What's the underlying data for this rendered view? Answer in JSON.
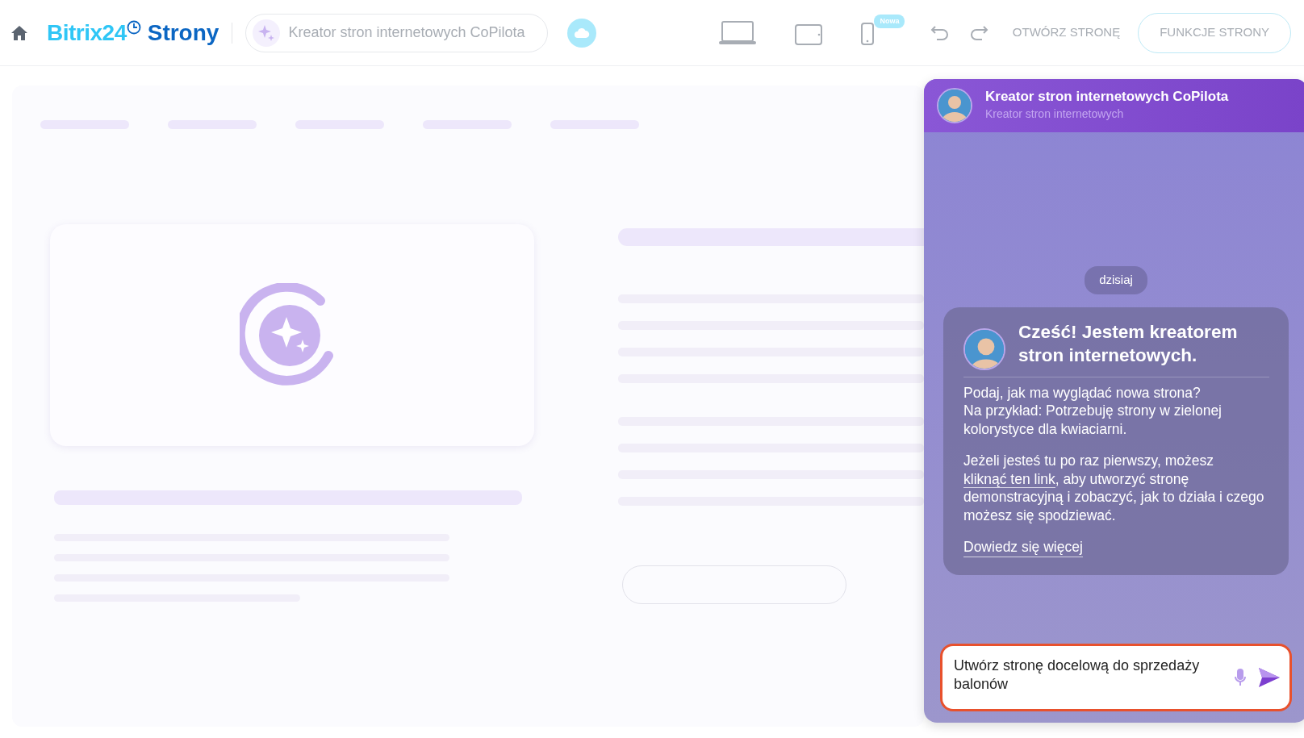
{
  "header": {
    "logo": {
      "brand": "Bitrix24",
      "product": "Strony"
    },
    "search": {
      "placeholder": "Kreator stron internetowych CoPilota"
    },
    "devices": [
      {
        "kind": "laptop"
      },
      {
        "kind": "tablet"
      },
      {
        "kind": "phone",
        "badge": "Nowa"
      }
    ],
    "open_page": "OTWÓRZ STRONĘ",
    "features_button": "FUNKCJE STRONY"
  },
  "chat": {
    "title": "Kreator stron internetowych CoPilota",
    "subtitle": "Kreator stron internetowych",
    "date": "dzisiaj",
    "message": {
      "heading": "Cześć! Jestem kreatorem stron internetowych.",
      "paragraph": "Podaj, jak ma wyglądać nowa strona?\nNa przykład: Potrzebuję strony w zielonej kolorystyce dla kwiaciarni.",
      "second": {
        "before": "Jeżeli jesteś tu po raz pierwszy, możesz",
        "link": "kliknąć ten link",
        "after": ", aby utworzyć stronę demonstracyjną i zobaczyć, jak to działa i czego możesz się spodziewać."
      },
      "more_link": "Dowiedz się więcej"
    },
    "input": {
      "value": "Utwórz stronę docelową do sprzedaży balonów"
    }
  }
}
